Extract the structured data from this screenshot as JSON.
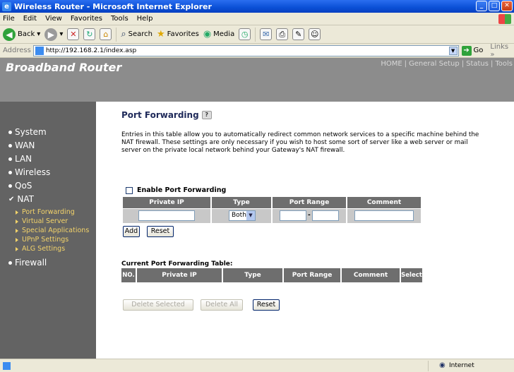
{
  "window": {
    "title": "Wireless Router - Microsoft Internet Explorer"
  },
  "menu": [
    "File",
    "Edit",
    "View",
    "Favorites",
    "Tools",
    "Help"
  ],
  "toolbar": {
    "back": "Back",
    "search": "Search",
    "favorites": "Favorites",
    "media": "Media"
  },
  "address": {
    "label": "Address",
    "url": "http://192.168.2.1/index.asp",
    "go": "Go",
    "links": "Links"
  },
  "header": {
    "brand": "Broadband Router",
    "nav": [
      "HOME",
      "General Setup",
      "Status",
      "Tools"
    ],
    "nav_separator": "|"
  },
  "sidebar": {
    "items": [
      {
        "label": "System"
      },
      {
        "label": "WAN"
      },
      {
        "label": "LAN"
      },
      {
        "label": "Wireless"
      },
      {
        "label": "QoS"
      },
      {
        "label": "NAT"
      }
    ],
    "nat_sub": [
      "Port Forwarding",
      "Virtual Server",
      "Special Applications",
      "UPnP Settings",
      "ALG Settings"
    ],
    "firewall": "Firewall"
  },
  "main": {
    "title": "Port Forwarding",
    "description": "Entries in this table allow you to automatically redirect common network services to a specific machine behind the NAT firewall. These settings are only necessary if you wish to host some sort of server like a web server or mail server on the private local network behind your Gateway's NAT firewall.",
    "enable_label": "Enable Port Forwarding",
    "form_headers": [
      "Private IP",
      "Type",
      "Port Range",
      "Comment"
    ],
    "type_selected": "Both",
    "range_separator": "-",
    "add_button": "Add",
    "reset_button": "Reset",
    "current_title": "Current Port Forwarding Table:",
    "table_headers": [
      "NO.",
      "Private IP",
      "Type",
      "Port Range",
      "Comment",
      "Select"
    ],
    "delete_selected": "Delete Selected",
    "delete_all": "Delete All",
    "reset2": "Reset"
  },
  "status": {
    "zone": "Internet"
  },
  "colors": {
    "title_bar": "#0a4fd6",
    "header_bg": "#8c8c8c",
    "sidebar_bg": "#636363",
    "table_header": "#6e6e6e",
    "sub_link": "#f3d36a"
  }
}
